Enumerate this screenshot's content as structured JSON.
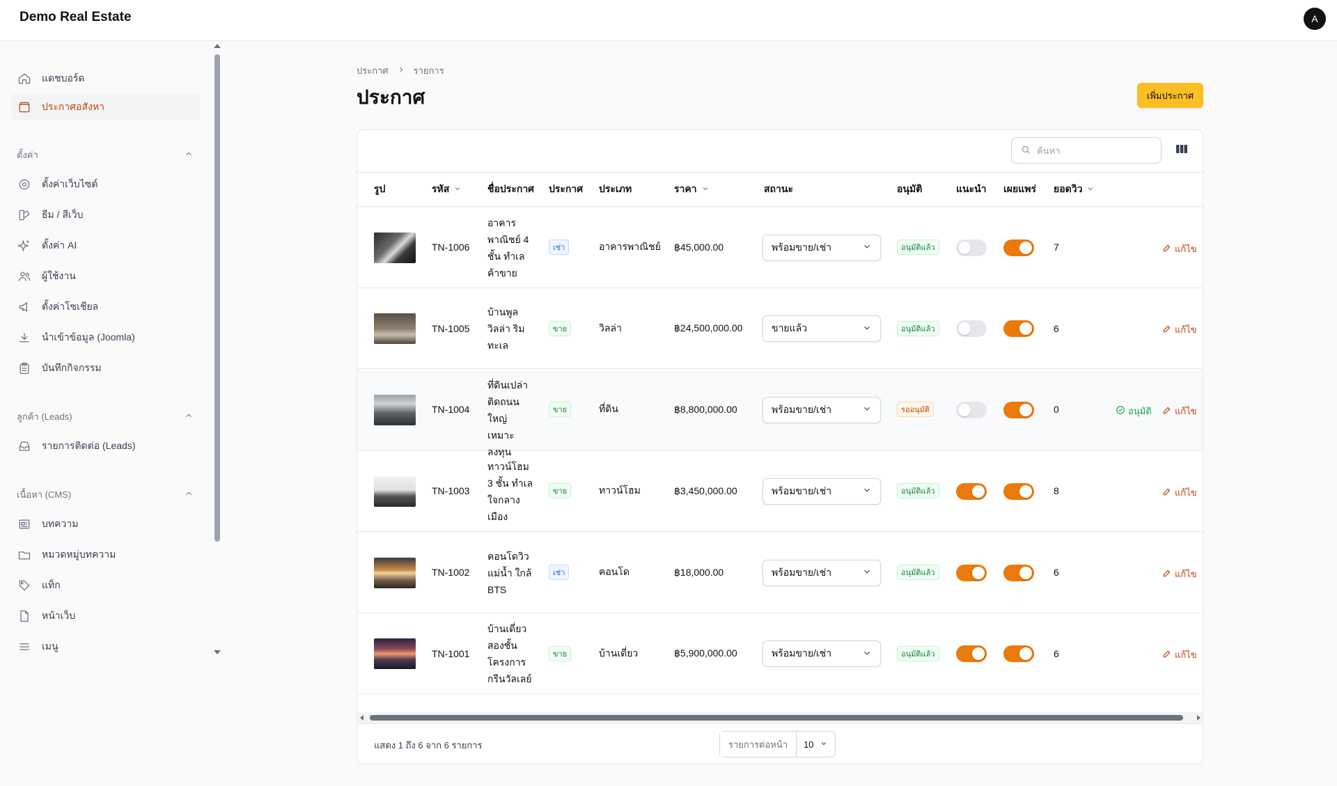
{
  "app": {
    "title": "Demo Real Estate",
    "avatar": "A"
  },
  "sidebar": {
    "items": [
      {
        "label": "แดชบอร์ด",
        "icon": "home-icon"
      },
      {
        "label": "ประกาศอสังหา",
        "icon": "box-icon",
        "active": true
      }
    ],
    "groups": [
      {
        "label": "ตั้งค่า",
        "items": [
          {
            "label": "ตั้งค่าเว็บไซต์",
            "icon": "gear-icon"
          },
          {
            "label": "ธีม / สีเว็บ",
            "icon": "palette-icon"
          },
          {
            "label": "ตั้งค่า AI",
            "icon": "sparkles-icon"
          },
          {
            "label": "ผู้ใช้งาน",
            "icon": "users-icon"
          },
          {
            "label": "ตั้งค่าโซเชียล",
            "icon": "megaphone-icon"
          },
          {
            "label": "นำเข้าข้อมูล (Joomla)",
            "icon": "download-icon"
          },
          {
            "label": "บันทึกกิจกรรม",
            "icon": "clipboard-icon"
          }
        ]
      },
      {
        "label": "ลูกค้า (Leads)",
        "items": [
          {
            "label": "รายการติดต่อ (Leads)",
            "icon": "inbox-icon"
          }
        ]
      },
      {
        "label": "เนื้อหา (CMS)",
        "items": [
          {
            "label": "บทความ",
            "icon": "newspaper-icon"
          },
          {
            "label": "หมวดหมู่บทความ",
            "icon": "folder-icon"
          },
          {
            "label": "แท็ก",
            "icon": "tag-icon"
          },
          {
            "label": "หน้าเว็บ",
            "icon": "document-icon"
          },
          {
            "label": "เมนู",
            "icon": "bars-icon"
          }
        ]
      }
    ]
  },
  "breadcrumb": {
    "root": "ประกาศ",
    "current": "รายการ"
  },
  "page": {
    "title": "ประกาศ",
    "add_button": "เพิ่มประกาศ"
  },
  "search": {
    "placeholder": "ค้นหา"
  },
  "table": {
    "headers": {
      "image": "รูป",
      "code": "รหัส",
      "name": "ชื่อประกาศ",
      "listing": "ประกาศ",
      "type": "ประเภท",
      "price": "ราคา",
      "status": "สถานะ",
      "approval": "อนุมัติ",
      "featured": "แนะนำ",
      "published": "เผยแพร่",
      "views": "ยอดวิว"
    },
    "edit_label": "แก้ไข",
    "approve_label": "อนุมัติ",
    "rows": [
      {
        "code": "TN-1006",
        "name": [
          "อาคาร",
          "พาณิชย์ 4",
          "ชั้น ทำเล",
          "ค้าขาย"
        ],
        "listing": "เช่า",
        "type": "อาคารพาณิชย์",
        "price": "฿45,000.00",
        "status": "พร้อมขาย/เช่า",
        "approval": "อนุมัติแล้ว",
        "featured": false,
        "published": true,
        "views": "7",
        "approve_action": false
      },
      {
        "code": "TN-1005",
        "name": [
          "บ้านพูล",
          "วิลล่า ริม",
          "ทะเล"
        ],
        "listing": "ขาย",
        "type": "วิลล่า",
        "price": "฿24,500,000.00",
        "status": "ขายแล้ว",
        "approval": "อนุมัติแล้ว",
        "featured": false,
        "published": true,
        "views": "6",
        "approve_action": false
      },
      {
        "code": "TN-1004",
        "name": [
          "ที่ดินเปล่า",
          "ติดถนน",
          "ใหญ่ เหมาะ",
          "ลงทุน"
        ],
        "listing": "ขาย",
        "type": "ที่ดิน",
        "price": "฿8,800,000.00",
        "status": "พร้อมขาย/เช่า",
        "approval": "รออนุมัติ",
        "featured": false,
        "published": true,
        "views": "0",
        "approve_action": true
      },
      {
        "code": "TN-1003",
        "name": [
          "ทาวน์โฮม",
          "3 ชั้น ทำเล",
          "ใจกลาง",
          "เมือง"
        ],
        "listing": "ขาย",
        "type": "ทาวน์โฮม",
        "price": "฿3,450,000.00",
        "status": "พร้อมขาย/เช่า",
        "approval": "อนุมัติแล้ว",
        "featured": true,
        "published": true,
        "views": "8",
        "approve_action": false
      },
      {
        "code": "TN-1002",
        "name": [
          "คอนโดวิว",
          "แม่น้ำ ใกล้",
          "BTS"
        ],
        "listing": "เช่า",
        "type": "คอนโด",
        "price": "฿18,000.00",
        "status": "พร้อมขาย/เช่า",
        "approval": "อนุมัติแล้ว",
        "featured": true,
        "published": true,
        "views": "6",
        "approve_action": false
      },
      {
        "code": "TN-1001",
        "name": [
          "บ้านเดี่ยว",
          "สองชั้น",
          "โครงการ",
          "กรีนวัลเลย์"
        ],
        "listing": "ขาย",
        "type": "บ้านเดี่ยว",
        "price": "฿5,900,000.00",
        "status": "พร้อมขาย/เช่า",
        "approval": "อนุมัติแล้ว",
        "featured": true,
        "published": true,
        "views": "6",
        "approve_action": false
      }
    ]
  },
  "footer": {
    "showing": "แสดง 1 ถึง 6 จาก 6 รายการ",
    "per_page_label": "รายการต่อหน้า",
    "per_page_value": "10"
  },
  "colors": {
    "accent": "#ea7a0c",
    "button": "#fbbf24",
    "active_text": "#c2410c"
  }
}
